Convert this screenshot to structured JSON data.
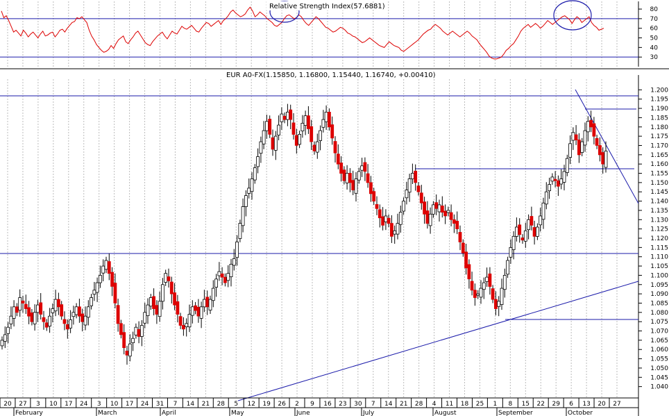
{
  "chart_data": [
    {
      "type": "line",
      "title": "Relative Strength Index(57.6881)",
      "ylim": [
        20,
        88
      ],
      "y_ticks": [
        "80",
        "70",
        "60",
        "50",
        "40",
        "30"
      ],
      "reference_lines": [
        70,
        30
      ],
      "series_color": "#dd0000",
      "series": [
        {
          "values": [
            78,
            71,
            73,
            68,
            62,
            56,
            58,
            55,
            52,
            58,
            55,
            51,
            54,
            56,
            53,
            50,
            54,
            57,
            52,
            53,
            55,
            56,
            51,
            54,
            58,
            59,
            56,
            60,
            63,
            66,
            67,
            71,
            70,
            72,
            69,
            66,
            58,
            52,
            48,
            43,
            40,
            37,
            35,
            36,
            38,
            42,
            39,
            44,
            48,
            50,
            52,
            46,
            44,
            48,
            51,
            55,
            57,
            53,
            49,
            45,
            43,
            42,
            46,
            49,
            52,
            54,
            56,
            52,
            49,
            53,
            57,
            55,
            54,
            58,
            62,
            60,
            59,
            61,
            63,
            60,
            57,
            56,
            60,
            63,
            66,
            65,
            62,
            64,
            66,
            68,
            64,
            68,
            70,
            73,
            77,
            79,
            76,
            74,
            72,
            73,
            75,
            79,
            82,
            78,
            72,
            74,
            77,
            75,
            73,
            70,
            68,
            66,
            63,
            62,
            64,
            66,
            70,
            73,
            74,
            72,
            70,
            71,
            74,
            72,
            68,
            65,
            63,
            66,
            69,
            72,
            70,
            67,
            64,
            61,
            60,
            58,
            56,
            57,
            59,
            61,
            60,
            58,
            55,
            54,
            52,
            51,
            49,
            47,
            45,
            46,
            48,
            50,
            48,
            46,
            44,
            42,
            41,
            40,
            43,
            46,
            44,
            42,
            41,
            40,
            37,
            36,
            38,
            40,
            42,
            44,
            46,
            48,
            51,
            54,
            56,
            58,
            59,
            62,
            64,
            62,
            60,
            57,
            55,
            53,
            55,
            57,
            55,
            53,
            51,
            53,
            55,
            57,
            55,
            52,
            50,
            48,
            44,
            41,
            38,
            35,
            31,
            29,
            28,
            28,
            29,
            30,
            33,
            37,
            39,
            42,
            44,
            48,
            52,
            57,
            60,
            62,
            64,
            61,
            63,
            65,
            63,
            60,
            62,
            65,
            68,
            66,
            64,
            66,
            68,
            70,
            72,
            73,
            71,
            69,
            65,
            69,
            72,
            70,
            66,
            68,
            70,
            72,
            66,
            63,
            61,
            58,
            59,
            60
          ]
        }
      ],
      "annotations": [
        "circle-upper-left",
        "circle-upper-right"
      ]
    },
    {
      "type": "candlestick",
      "title": "EUR A0-FX(1.15850, 1.16800, 1.15440, 1.16740, +0.00410)",
      "ylim": [
        1.035,
        1.205
      ],
      "y_ticks": [
        "1.200",
        "1.195",
        "1.190",
        "1.185",
        "1.180",
        "1.175",
        "1.170",
        "1.165",
        "1.160",
        "1.155",
        "1.150",
        "1.145",
        "1.140",
        "1.135",
        "1.130",
        "1.125",
        "1.120",
        "1.115",
        "1.110",
        "1.105",
        "1.100",
        "1.095",
        "1.090",
        "1.085",
        "1.080",
        "1.075",
        "1.070",
        "1.065",
        "1.060",
        "1.055",
        "1.050",
        "1.045",
        "1.040"
      ],
      "x_tick_labels": [
        "20",
        "27",
        "3",
        "10",
        "17",
        "24",
        "3",
        "10",
        "17",
        "24",
        "31",
        "7",
        "14",
        "21",
        "28",
        "5",
        "12",
        "19",
        "26",
        "2",
        "9",
        "16",
        "23",
        "30",
        "7",
        "14",
        "21",
        "28",
        "4",
        "11",
        "18",
        "25",
        "1",
        "8",
        "15",
        "22",
        "29",
        "6",
        "13",
        "20",
        "27"
      ],
      "month_labels": [
        "February",
        "March",
        "April",
        "May",
        "June",
        "July",
        "August",
        "September",
        "October"
      ],
      "up_color": "#ffffff",
      "down_color": "#dd0000",
      "close": [
        1.065,
        1.068,
        1.072,
        1.078,
        1.083,
        1.08,
        1.088,
        1.085,
        1.082,
        1.078,
        1.075,
        1.08,
        1.084,
        1.079,
        1.075,
        1.072,
        1.078,
        1.082,
        1.087,
        1.083,
        1.078,
        1.074,
        1.071,
        1.076,
        1.08,
        1.083,
        1.078,
        1.075,
        1.078,
        1.083,
        1.088,
        1.092,
        1.096,
        1.1,
        1.105,
        1.108,
        1.101,
        1.094,
        1.085,
        1.074,
        1.068,
        1.061,
        1.057,
        1.063,
        1.066,
        1.072,
        1.067,
        1.073,
        1.08,
        1.084,
        1.088,
        1.082,
        1.079,
        1.086,
        1.095,
        1.101,
        1.097,
        1.09,
        1.084,
        1.079,
        1.073,
        1.071,
        1.074,
        1.079,
        1.083,
        1.081,
        1.078,
        1.083,
        1.087,
        1.083,
        1.087,
        1.093,
        1.098,
        1.102,
        1.099,
        1.096,
        1.101,
        1.106,
        1.109,
        1.118,
        1.128,
        1.137,
        1.143,
        1.147,
        1.152,
        1.158,
        1.164,
        1.172,
        1.178,
        1.183,
        1.176,
        1.168,
        1.175,
        1.181,
        1.187,
        1.184,
        1.188,
        1.184,
        1.176,
        1.17,
        1.176,
        1.182,
        1.186,
        1.179,
        1.172,
        1.167,
        1.172,
        1.178,
        1.184,
        1.188,
        1.18,
        1.174,
        1.166,
        1.16,
        1.155,
        1.151,
        1.155,
        1.15,
        1.146,
        1.152,
        1.156,
        1.159,
        1.156,
        1.15,
        1.144,
        1.14,
        1.136,
        1.131,
        1.127,
        1.132,
        1.128,
        1.121,
        1.124,
        1.128,
        1.134,
        1.14,
        1.146,
        1.152,
        1.155,
        1.15,
        1.145,
        1.139,
        1.133,
        1.128,
        1.133,
        1.138,
        1.136,
        1.138,
        1.134,
        1.132,
        1.135,
        1.13,
        1.128,
        1.125,
        1.118,
        1.112,
        1.104,
        1.098,
        1.092,
        1.088,
        1.09,
        1.093,
        1.096,
        1.099,
        1.094,
        1.087,
        1.082,
        1.086,
        1.093,
        1.1,
        1.108,
        1.115,
        1.121,
        1.126,
        1.122,
        1.119,
        1.124,
        1.13,
        1.127,
        1.121,
        1.126,
        1.132,
        1.139,
        1.145,
        1.149,
        1.153,
        1.151,
        1.148,
        1.152,
        1.156,
        1.163,
        1.171,
        1.177,
        1.173,
        1.165,
        1.172,
        1.178,
        1.183,
        1.18,
        1.175,
        1.17,
        1.165,
        1.16,
        1.167
      ]
    }
  ]
}
